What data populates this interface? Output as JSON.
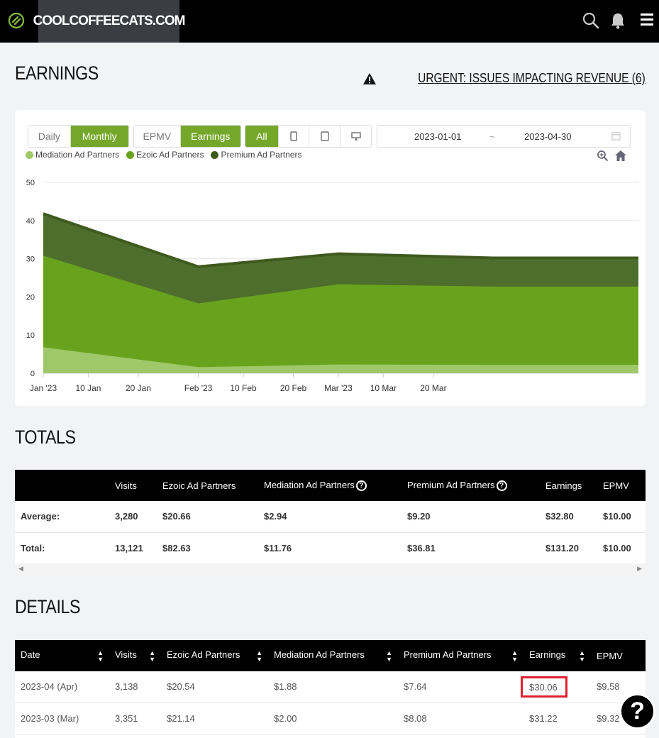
{
  "header": {
    "site_name": "COOLCOFFEECATS.COM"
  },
  "earnings_section": {
    "title": "EARNINGS",
    "urgent_link": "URGENT: ISSUES IMPACTING REVENUE (6)"
  },
  "controls": {
    "period": [
      {
        "label": "Daily",
        "active": false
      },
      {
        "label": "Monthly",
        "active": true
      }
    ],
    "metric": [
      {
        "label": "EPMV",
        "active": false
      },
      {
        "label": "Earnings",
        "active": true
      }
    ],
    "device": {
      "all_label": "All",
      "icons": [
        "mobile-icon",
        "tablet-icon",
        "desktop-icon"
      ]
    },
    "date_start": "2023-01-01",
    "date_separator": "~",
    "date_end": "2023-04-30"
  },
  "chart_data": {
    "type": "area",
    "stacked": true,
    "x": [
      "2023-01-01",
      "2023-02-01",
      "2023-03-01",
      "2023-04-01",
      "2023-04-30"
    ],
    "x_tick_labels": [
      "Jan '23",
      "10 Jan",
      "20 Jan",
      "Feb '23",
      "10 Feb",
      "20 Feb",
      "Mar '23",
      "10 Mar",
      "20 Mar"
    ],
    "x_tick_dates": [
      "2023-01-01",
      "2023-01-10",
      "2023-01-20",
      "2023-02-01",
      "2023-02-10",
      "2023-02-20",
      "2023-03-01",
      "2023-03-10",
      "2023-03-20"
    ],
    "y_ticks": [
      0,
      10,
      20,
      30,
      40,
      50
    ],
    "ylim": [
      0,
      50
    ],
    "series": [
      {
        "name": "Mediation Ad Partners",
        "color": "#9fc86a",
        "values": [
          6.8,
          1.6,
          2.3,
          2.2,
          2.2
        ]
      },
      {
        "name": "Ezoic Ad Partners",
        "color": "#69a31d",
        "values": [
          24.0,
          16.7,
          21.0,
          20.5,
          20.5
        ]
      },
      {
        "name": "Premium Ad Partners",
        "color": "#4e6e2d",
        "values": [
          11.0,
          9.6,
          8.0,
          7.5,
          7.5
        ]
      }
    ],
    "grid": true,
    "legend_position": "top-left"
  },
  "totals_section": {
    "title": "TOTALS",
    "headers": [
      "",
      "Visits",
      "Ezoic Ad Partners",
      "Mediation Ad Partners",
      "Premium Ad Partners",
      "Earnings",
      "EPMV"
    ],
    "rows": [
      [
        "Average:",
        "3,280",
        "$20.66",
        "$2.94",
        "$9.20",
        "$32.80",
        "$10.00"
      ],
      [
        "Total:",
        "13,121",
        "$82.63",
        "$11.76",
        "$36.81",
        "$131.20",
        "$10.00"
      ]
    ]
  },
  "details_section": {
    "title": "DETAILS",
    "headers": [
      "Date",
      "Visits",
      "Ezoic Ad Partners",
      "Mediation Ad Partners",
      "Premium Ad Partners",
      "Earnings",
      "EPMV"
    ],
    "rows": [
      [
        "2023-04 (Apr)",
        "3,138",
        "$20.54",
        "$1.88",
        "$7.64",
        "$30.06",
        "$9.58"
      ],
      [
        "2023-03 (Mar)",
        "3,351",
        "$21.14",
        "$2.00",
        "$8.08",
        "$31.22",
        "$9.32"
      ]
    ]
  },
  "help_button": {
    "label": "?"
  }
}
